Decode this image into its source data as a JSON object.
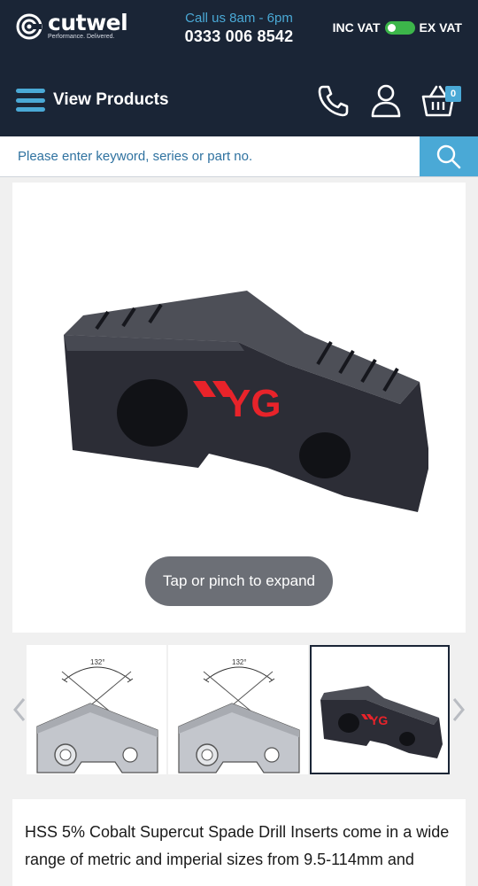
{
  "header": {
    "brand": "cutwel",
    "tagline": "Performance. Delivered.",
    "call_hours": "Call us 8am - 6pm",
    "phone": "0333 006 8542",
    "vat_left": "INC VAT",
    "vat_right": "EX VAT",
    "menu_label": "View Products",
    "basket_count": "0"
  },
  "search": {
    "placeholder": "Please enter keyword, series or part no."
  },
  "product": {
    "logo_text": "YG",
    "expand_hint": "Tap or pinch to expand"
  },
  "thumbnails": [
    {
      "angle_label": "132°"
    },
    {
      "angle_label": "132°"
    },
    {
      "logo_text": "YG"
    }
  ],
  "description": "HSS 5% Cobalt Supercut Spade Drill Inserts come in a wide range of metric and imperial sizes from 9.5-114mm and",
  "colors": {
    "header_bg": "#1a2536",
    "accent_blue": "#4aa9d6",
    "toggle_green": "#3cb64a",
    "yg_red": "#e8232a"
  }
}
